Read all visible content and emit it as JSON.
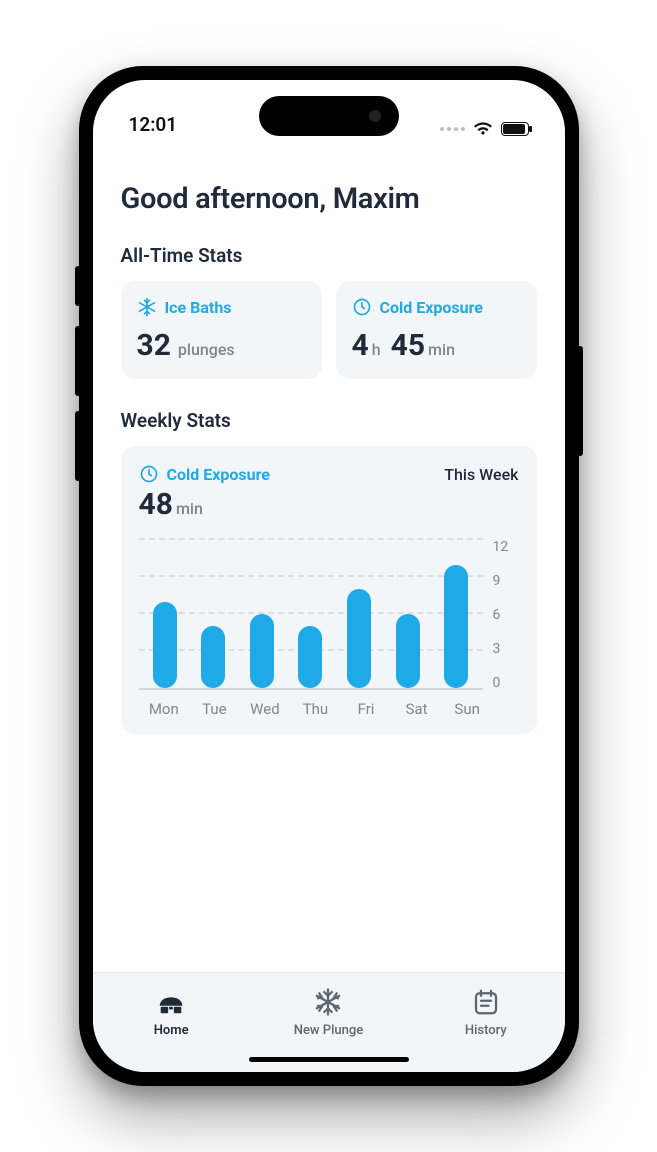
{
  "statusbar": {
    "time": "12:01"
  },
  "greeting": "Good afternoon, Maxim",
  "alltime": {
    "title": "All-Time Stats",
    "ice": {
      "label": "Ice Baths",
      "value": "32",
      "unit": "plunges"
    },
    "exposure": {
      "label": "Cold Exposure",
      "h": "4",
      "h_unit": "h",
      "m": "45",
      "m_unit": "min"
    }
  },
  "weekly": {
    "title": "Weekly Stats",
    "card_label": "Cold Exposure",
    "period": "This Week",
    "value": "48",
    "unit": "min"
  },
  "chart_data": {
    "type": "bar",
    "categories": [
      "Mon",
      "Tue",
      "Wed",
      "Thu",
      "Fri",
      "Sat",
      "Sun"
    ],
    "values": [
      7,
      5,
      6,
      5,
      8,
      6,
      10
    ],
    "ylabel": "",
    "xlabel": "",
    "yticks": [
      12,
      9,
      6,
      3,
      0
    ],
    "ylim": [
      0,
      12
    ]
  },
  "tabs": {
    "home": "Home",
    "new": "New Plunge",
    "history": "History"
  }
}
